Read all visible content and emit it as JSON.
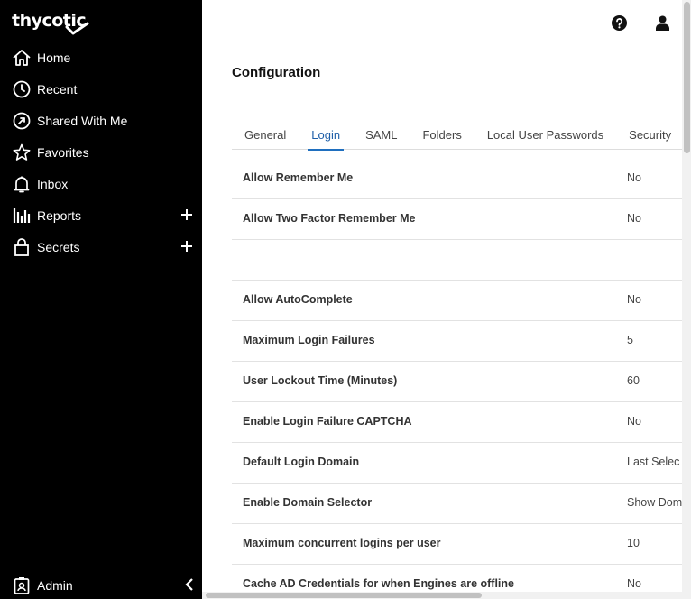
{
  "brand": {
    "logo_text": "thycotic"
  },
  "sidebar": {
    "items": [
      {
        "label": "Home",
        "icon": "home-icon"
      },
      {
        "label": "Recent",
        "icon": "clock-icon"
      },
      {
        "label": "Shared With Me",
        "icon": "share-icon"
      },
      {
        "label": "Favorites",
        "icon": "star-icon"
      },
      {
        "label": "Inbox",
        "icon": "bell-icon"
      },
      {
        "label": "Reports",
        "icon": "bar-chart-icon"
      },
      {
        "label": "Secrets",
        "icon": "lock-icon"
      }
    ],
    "admin_label": "Admin"
  },
  "header": {
    "help_icon": "help-icon",
    "user_icon": "user-icon"
  },
  "page": {
    "title": "Configuration"
  },
  "tabs": [
    {
      "label": "General"
    },
    {
      "label": "Login",
      "active": true
    },
    {
      "label": "SAML"
    },
    {
      "label": "Folders"
    },
    {
      "label": "Local User Passwords"
    },
    {
      "label": "Security"
    }
  ],
  "settings": [
    {
      "label": "Allow Remember Me",
      "value": "No"
    },
    {
      "label": "Allow Two Factor Remember Me",
      "value": "No"
    },
    {
      "label": "",
      "value": ""
    },
    {
      "label": "Allow AutoComplete",
      "value": "No"
    },
    {
      "label": "Maximum Login Failures",
      "value": "5"
    },
    {
      "label": "User Lockout Time (Minutes)",
      "value": "60"
    },
    {
      "label": "Enable Login Failure CAPTCHA",
      "value": "No"
    },
    {
      "label": "Default Login Domain",
      "value": "Last Selec"
    },
    {
      "label": "Enable Domain Selector",
      "value": "Show Dom"
    },
    {
      "label": "Maximum concurrent logins per user",
      "value": "10"
    },
    {
      "label": "Cache AD Credentials for when Engines are offline",
      "value": "No"
    }
  ],
  "colors": {
    "sidebar_bg": "#000000",
    "active_tab": "#1f6fbf"
  }
}
